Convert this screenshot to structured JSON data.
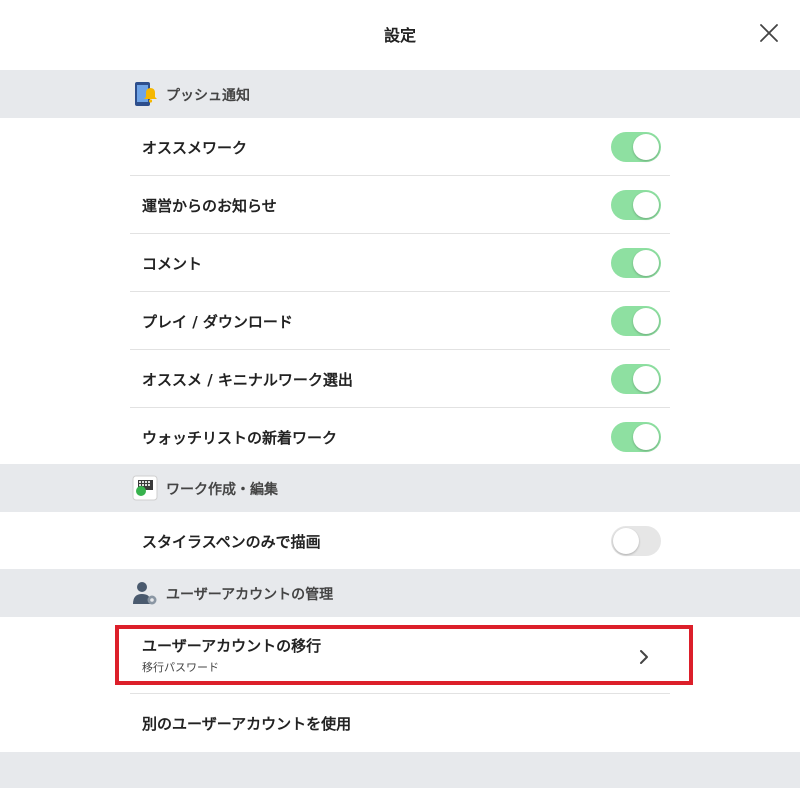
{
  "header": {
    "title": "設定",
    "close_icon": "close-icon"
  },
  "sections": {
    "push": {
      "label": "プッシュ通知",
      "icon": "phone-bell-icon",
      "items": [
        {
          "label": "オススメワーク",
          "toggle": "on"
        },
        {
          "label": "運営からのお知らせ",
          "toggle": "on"
        },
        {
          "label": "コメント",
          "toggle": "on"
        },
        {
          "label": "プレイ / ダウンロード",
          "toggle": "on"
        },
        {
          "label": "オススメ / キニナルワーク選出",
          "toggle": "on"
        },
        {
          "label": "ウォッチリストの新着ワーク",
          "toggle": "on"
        }
      ]
    },
    "edit": {
      "label": "ワーク作成・編集",
      "icon": "keyboard-icon",
      "items": [
        {
          "label": "スタイラスペンのみで描画",
          "toggle": "off"
        }
      ]
    },
    "account": {
      "label": "ユーザーアカウントの管理",
      "icon": "user-gear-icon",
      "migrate": {
        "label": "ユーザーアカウントの移行",
        "sublabel": "移行パスワード",
        "icon": "chevron-right-icon"
      },
      "other": {
        "label": "別のユーザーアカウントを使用"
      }
    }
  },
  "colors": {
    "toggle_on": "#8ee0a1",
    "toggle_off": "#e6e6e6",
    "section_bg": "#e7e9ec",
    "highlight": "#dc1f2a"
  }
}
